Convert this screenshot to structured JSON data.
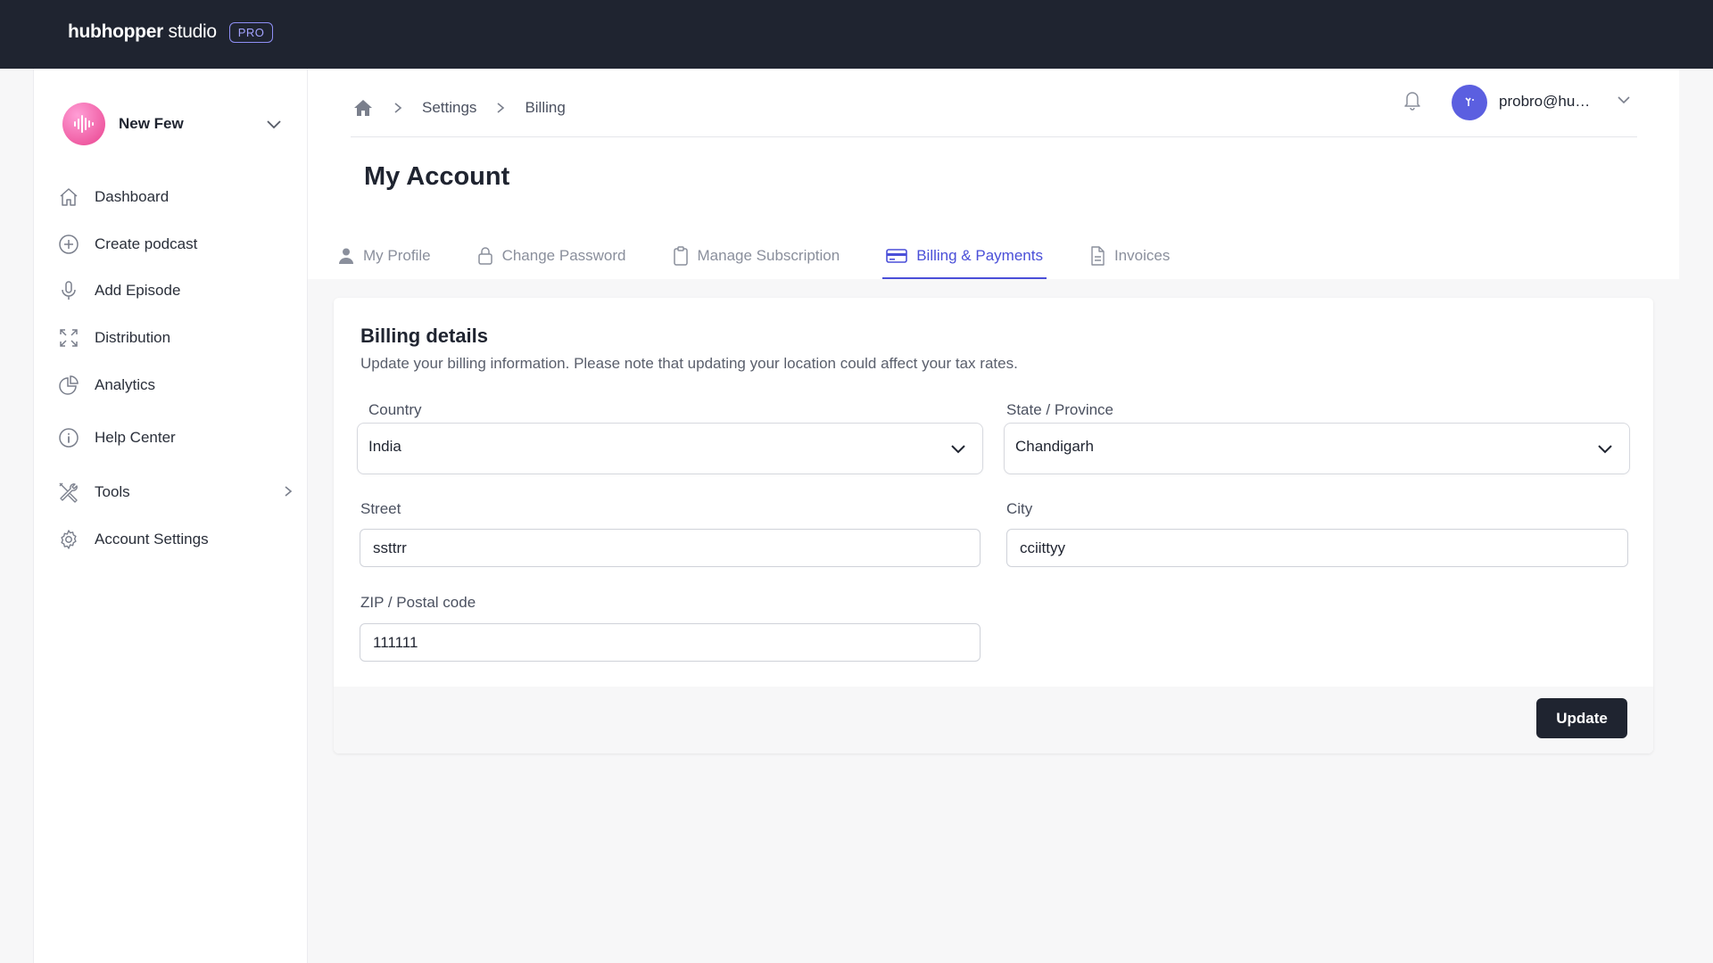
{
  "topbar": {
    "brand_bold": "hubhopper",
    "brand_light": " studio",
    "badge": "PRO"
  },
  "sidebar": {
    "podcast_name": "New Few",
    "items": [
      {
        "label": "Dashboard",
        "icon": "home-icon"
      },
      {
        "label": "Create podcast",
        "icon": "plus-circle-icon"
      },
      {
        "label": "Add Episode",
        "icon": "microphone-icon"
      },
      {
        "label": "Distribution",
        "icon": "expand-arrows-icon"
      },
      {
        "label": "Analytics",
        "icon": "pie-chart-icon"
      },
      {
        "label": "Help Center",
        "icon": "info-circle-icon"
      },
      {
        "label": "Tools",
        "icon": "tools-icon"
      },
      {
        "label": "Account Settings",
        "icon": "gear-icon"
      }
    ]
  },
  "header": {
    "breadcrumb": [
      "Settings",
      "Billing"
    ],
    "user_email": "probro@hu…",
    "page_title": "My Account",
    "tabs": [
      {
        "label": "My Profile",
        "icon": "user-icon"
      },
      {
        "label": "Change Password",
        "icon": "lock-icon"
      },
      {
        "label": "Manage Subscription",
        "icon": "clipboard-icon"
      },
      {
        "label": "Billing & Payments",
        "icon": "credit-card-icon",
        "active": true
      },
      {
        "label": "Invoices",
        "icon": "document-icon"
      }
    ]
  },
  "billing": {
    "title": "Billing details",
    "subtitle": "Update your billing information. Please note that updating your location could affect your tax rates.",
    "country_label": "Country",
    "country_value": "India",
    "state_label": "State / Province",
    "state_value": "Chandigarh",
    "street_label": "Street",
    "street_value": "ssttrr",
    "city_label": "City",
    "city_value": "cciittyy",
    "zip_label": "ZIP / Postal code",
    "zip_value": "111111",
    "update_label": "Update"
  },
  "colors": {
    "topbar": "#1f2430",
    "accent": "#4a4fd8",
    "button": "#1f2430",
    "avatar": "#5b5fe0"
  }
}
